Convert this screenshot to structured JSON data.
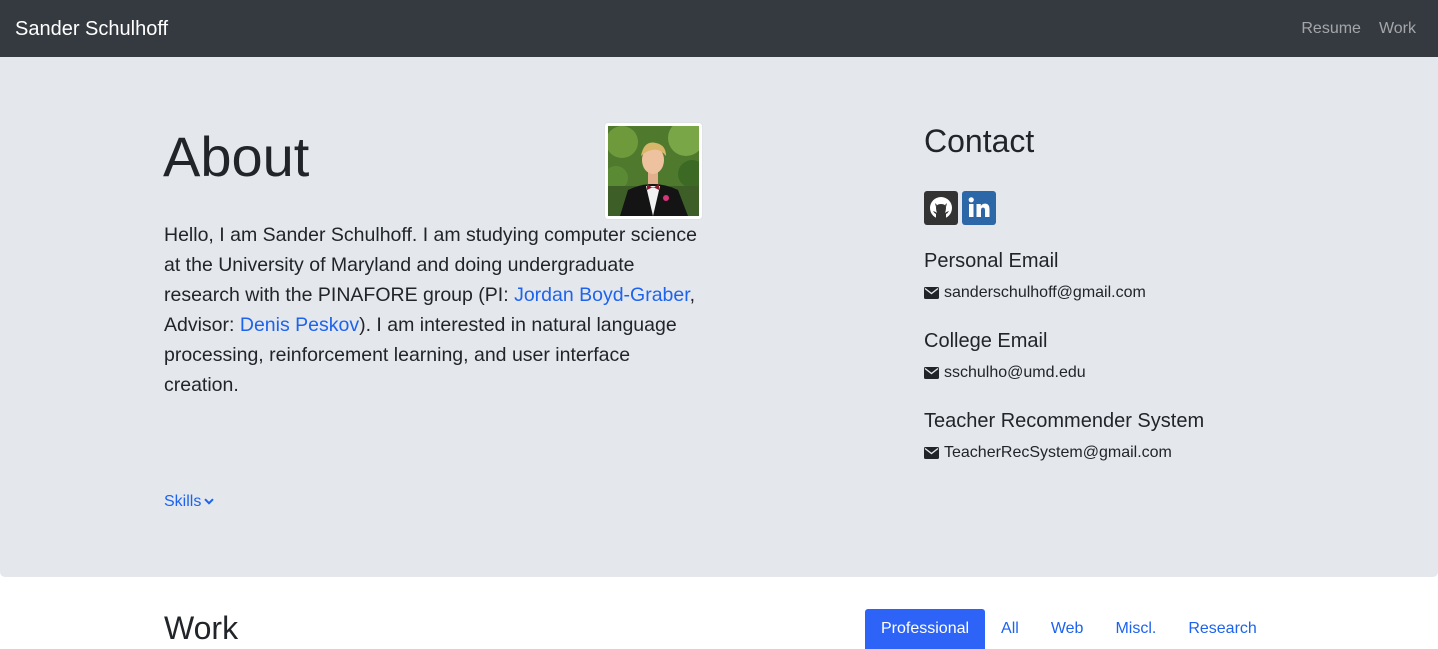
{
  "navbar": {
    "brand": "Sander Schulhoff",
    "links": [
      "Resume",
      "Work"
    ]
  },
  "about": {
    "title": "About",
    "paragraph": {
      "part1": "Hello, I am Sander Schulhoff. I am studying computer science at the University of Maryland and doing undergraduate research with the PINAFORE group (PI: ",
      "pi_link": "Jordan Boyd-Graber",
      "part2": ", Advisor: ",
      "advisor_link": "Denis Peskov",
      "part3": "). I am interested in natural language processing, reinforcement learning, and user interface creation."
    },
    "skills_label": "Skills",
    "skills_icon": "chevron-down-icon",
    "avatar_alt": "profile-photo"
  },
  "contact": {
    "title": "Contact",
    "social": [
      {
        "icon": "github-icon"
      },
      {
        "icon": "linkedin-icon"
      }
    ],
    "groups": [
      {
        "title": "Personal Email",
        "email": "sanderschulhoff@gmail.com"
      },
      {
        "title": "College Email",
        "email": "sschulho@umd.edu"
      },
      {
        "title": "Teacher Recommender System",
        "email": "TeacherRecSystem@gmail.com"
      }
    ]
  },
  "work": {
    "title": "Work",
    "tabs": [
      "Professional",
      "All",
      "Web",
      "Miscl.",
      "Research"
    ],
    "active_tab": "Professional"
  },
  "colors": {
    "navbar_bg": "#343a40",
    "jumbotron_bg": "#e4e8ec",
    "link": "#1d63ed",
    "active_tab_bg": "#2d63f7",
    "linkedin": "#2c67a8",
    "github": "#333333"
  }
}
